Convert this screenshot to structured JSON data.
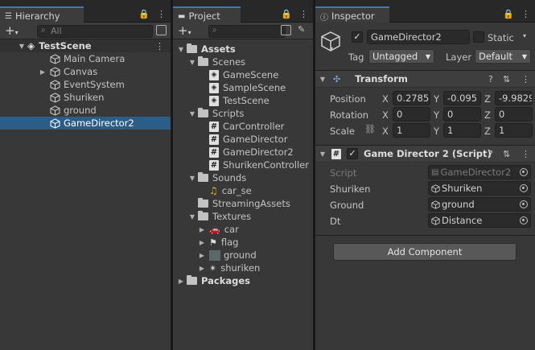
{
  "hierarchy": {
    "tab_label": "Hierarchy",
    "search_placeholder": "All",
    "scene_name": "TestScene",
    "items": [
      {
        "label": "Main Camera"
      },
      {
        "label": "Canvas"
      },
      {
        "label": "EventSystem"
      },
      {
        "label": "Shuriken"
      },
      {
        "label": "ground"
      },
      {
        "label": "GameDirector2"
      }
    ],
    "selected": "GameDirector2"
  },
  "project": {
    "tab_label": "Project",
    "root": "Assets",
    "folders": [
      {
        "label": "Scenes",
        "items": [
          "GameScene",
          "SampleScene",
          "TestScene"
        ]
      },
      {
        "label": "Scripts",
        "items": [
          "CarController",
          "GameDirector",
          "GameDirector2",
          "ShurikenController"
        ]
      },
      {
        "label": "Sounds",
        "items": [
          "car_se"
        ]
      },
      {
        "label": "StreamingAssets",
        "items": []
      },
      {
        "label": "Textures",
        "items": [
          "car",
          "flag",
          "ground",
          "shuriken"
        ]
      }
    ],
    "packages": "Packages"
  },
  "inspector": {
    "tab_label": "Inspector",
    "object_name": "GameDirector2",
    "static_label": "Static",
    "tag_label": "Tag",
    "tag_value": "Untagged",
    "layer_label": "Layer",
    "layer_value": "Default",
    "transform": {
      "title": "Transform",
      "position_label": "Position",
      "rotation_label": "Rotation",
      "scale_label": "Scale",
      "position": {
        "x": "0.2785",
        "y": "-0.095",
        "z": "-9.9829"
      },
      "rotation": {
        "x": "0",
        "y": "0",
        "z": "0"
      },
      "scale": {
        "x": "1",
        "y": "1",
        "z": "1"
      }
    },
    "script_component": {
      "title": "Game Director 2 (Script)",
      "script_label": "Script",
      "script_value": "GameDirector2",
      "fields": [
        {
          "label": "Shuriken",
          "value": "Shuriken"
        },
        {
          "label": "Ground",
          "value": "ground"
        },
        {
          "label": "Dt",
          "value": "Distance"
        }
      ]
    },
    "add_component": "Add Component"
  },
  "colors": {
    "selection": "#2c5d87",
    "accent": "#3a79bb"
  }
}
